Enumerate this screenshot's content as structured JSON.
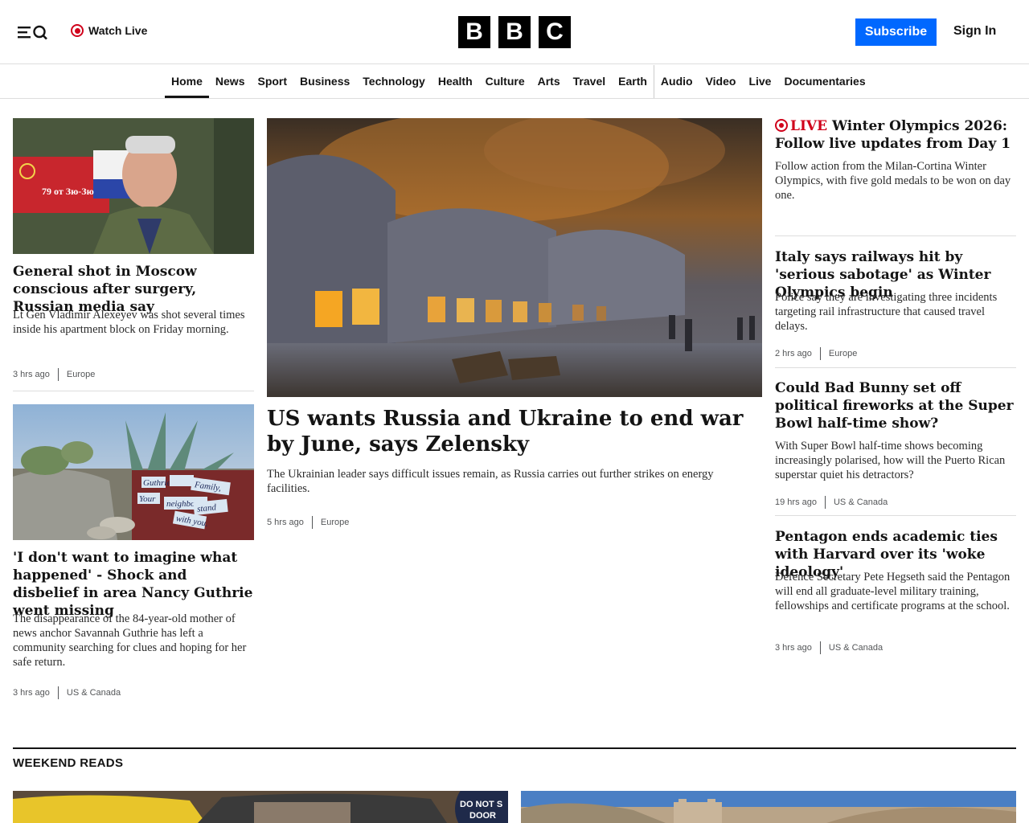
{
  "header": {
    "watch_live": "Watch Live",
    "logo_letters": [
      "B",
      "B",
      "C"
    ],
    "subscribe": "Subscribe",
    "sign_in": "Sign In"
  },
  "nav": {
    "items": [
      "Home",
      "News",
      "Sport",
      "Business",
      "Technology",
      "Health",
      "Culture",
      "Arts",
      "Travel",
      "Earth",
      "Audio",
      "Video",
      "Live",
      "Documentaries"
    ],
    "active": "Home"
  },
  "stories": {
    "left1": {
      "headline": "General shot in Moscow conscious after surgery, Russian media say",
      "summary": "Lt Gen Vladimir Alexeyev was shot several times inside his apartment block on Friday morning.",
      "time": "3 hrs ago",
      "category": "Europe",
      "image_text": "79 от Зю-Зю"
    },
    "left2": {
      "headline": "'I don't want to imagine what happened' - Shock and disbelief in area Nancy Guthrie went missing",
      "summary": "The disappearance of the 84-year-old mother of news anchor Savannah Guthrie has left a community searching for clues and hoping for her safe return.",
      "time": "3 hrs ago",
      "category": "US & Canada",
      "sign_words": [
        "Guthrie",
        "Family,",
        "Your",
        "neighbors",
        "stand",
        "with you."
      ]
    },
    "main": {
      "headline": "US wants Russia and Ukraine to end war by June, says Zelensky",
      "summary": "The Ukrainian leader says difficult issues remain, as Russia carries out further strikes on energy facilities.",
      "time": "5 hrs ago",
      "category": "Europe"
    },
    "right1": {
      "live_label": "LIVE",
      "headline": "Winter Olympics 2026: Follow live updates from Day 1",
      "summary": "Follow action from the Milan-Cortina Winter Olympics, with five gold medals to be won on day one."
    },
    "right2": {
      "headline": "Italy says railways hit by 'serious sabotage' as Winter Olympics begin",
      "summary": "Police say they are investigating three incidents targeting rail infrastructure that caused travel delays.",
      "time": "2 hrs ago",
      "category": "Europe"
    },
    "right3": {
      "headline": "Could Bad Bunny set off political fireworks at the Super Bowl half-time show?",
      "summary": "With Super Bowl half-time shows becoming increasingly polarised, how will the Puerto Rican superstar quiet his detractors?",
      "time": "19 hrs ago",
      "category": "US & Canada"
    },
    "right4": {
      "headline": "Pentagon ends academic ties with Harvard over its 'woke ideology'",
      "summary": "Defence Secretary Pete Hegseth said the Pentagon will end all graduate-level military training, fellowships and certificate programs at the school.",
      "time": "3 hrs ago",
      "category": "US & Canada"
    }
  },
  "weekend_reads": {
    "title": "WEEKEND READS",
    "card1_sign": [
      "DO NOT S",
      "DOOR"
    ]
  },
  "colors": {
    "brand_black": "#000000",
    "subscribe_blue": "#0068ff",
    "live_red": "#d0021b"
  },
  "icons": [
    "menu-icon",
    "search-icon",
    "live-icon"
  ]
}
